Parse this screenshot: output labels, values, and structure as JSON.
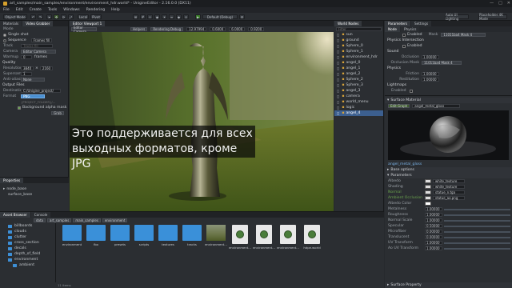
{
  "window": {
    "title": "art_samples/main_samples/environment/environment_hdr.world* - UnigineEditor - 2.16.0.0 (DX11)",
    "controls": [
      "—",
      "□",
      "✕"
    ]
  },
  "menu": [
    "File",
    "Edit",
    "Create",
    "Tools",
    "Windows",
    "Rendering",
    "Help"
  ],
  "toolbar": {
    "object_mode": "Object Mode",
    "local": "Local",
    "pivot": "Pivot",
    "play_label": "Default (Debug)",
    "fps_label": "Auto UI Lighting",
    "theme_label": "Placeholder 4K Mode"
  },
  "left_panel": {
    "tabs": [
      "Materials",
      "Video Grabber"
    ],
    "mode_label": "Mode",
    "modes": [
      "Single shot",
      "Sequence"
    ],
    "fps_label": "FPS",
    "fps_value": "Frames fill",
    "track_label": "Track",
    "track_value": "Tracks fill",
    "camera_label": "Camera",
    "camera_value": "Editor Camera",
    "warmup_label": "Warmup",
    "warmup_value": "0",
    "warmup_unit": "frames",
    "quality_section": "Quality",
    "resolution_label": "Resolution",
    "res_w": "3840",
    "res_h": "2160",
    "supersampling_label": "Supersampling",
    "supersampling_value": "1",
    "anti_alias_label": "Anti-aliasing",
    "anti_alias_value": "None",
    "output_section": "Output Files",
    "destination_label": "Destination",
    "destination_value": "C:/Unigine_project/",
    "format_label": "Format",
    "format_value": "PNG",
    "filename_hint": "{PROJECT_FOLDER}/...",
    "background_alpha": "Background alpha mask",
    "grab_button": "Grab"
  },
  "properties_panel": {
    "title": "Properties",
    "items": [
      "node_base",
      "surface_base"
    ]
  },
  "viewport": {
    "tab": "Editor Viewport 1",
    "camera_label": "Editor Camera",
    "overlay_items": [
      "Helpers",
      "Rendering Debug",
      "Mode",
      "Speed"
    ],
    "speed_values": [
      "12.97994",
      "0.6000",
      "6.0000",
      "0.9200"
    ]
  },
  "subtitle": {
    "line1": "Это поддерживается для всех",
    "line2": "выходных форматов, кроме JPG"
  },
  "world_nodes": {
    "title": "World Nodes",
    "filter_placeholder": "Filter",
    "items": [
      "sun",
      "ground",
      "Sphere_0",
      "Sphere_1",
      "environment_hdr",
      "angel_0",
      "angel_1",
      "angel_2",
      "Sphere_2",
      "Sphere_3",
      "angel_3",
      "camera",
      "world_menu",
      "logic",
      "angel_4"
    ],
    "selected_index": 14
  },
  "parameters": {
    "tabs": [
      "Parameters",
      "Settings"
    ],
    "subtabs": [
      "Node",
      "Physics"
    ],
    "enabled_label": "Enabled",
    "mask_label": "Mask",
    "mask_value": "11011ba4 Mask 4",
    "physics_intersection": "Physics Intersection",
    "sound_section": "Sound",
    "occlusion_label": "Occlusion",
    "occlusion_value": "1.00000",
    "occlusion_mask_label": "Occlusion Mask",
    "physics_section": "Physics",
    "friction_label": "Friction",
    "friction_value": "1.00000",
    "restitution_label": "Restitution",
    "restitution_value": "1.00000",
    "lightmaps_section": "Lightmaps",
    "surface_material_section": "Surface Material",
    "edit_graph": "Edit Graph",
    "material_name": "angel_metal_gloss",
    "base_options": "Base options",
    "parameters_section": "Parameters",
    "params": [
      {
        "label": "Albedo",
        "value": "white_texture"
      },
      {
        "label": "Shading",
        "value": "white_texture"
      },
      {
        "label": "Normal",
        "value": "statue_n.tga",
        "highlight": true
      },
      {
        "label": "Ambient Occlusion",
        "value": "statue_ao.png",
        "highlight": true
      },
      {
        "label": "Albedo Color",
        "value": ""
      },
      {
        "label": "Metalness",
        "value": "1.00000"
      },
      {
        "label": "Roughness",
        "value": "1.00000"
      },
      {
        "label": "Normal Scale",
        "value": "1.00000"
      },
      {
        "label": "Specular",
        "value": "0.50000"
      },
      {
        "label": "Microfiber",
        "value": "0.00000"
      },
      {
        "label": "Translucent",
        "value": "0.00000"
      },
      {
        "label": "UV Transform",
        "value": "1.00000"
      },
      {
        "label": "Ao UV Transform",
        "value": "1.00000"
      }
    ],
    "surface_property": "Surface Property",
    "colors": {
      "accent": "#3c5f8f",
      "highlight": "#6aa34d"
    }
  },
  "asset_browser": {
    "tabs": [
      "Asset Browser",
      "Console"
    ],
    "breadcrumb": [
      "data",
      "art_samples",
      "main_samples",
      "environment"
    ],
    "folders": [
      "billboards",
      "clouds",
      "clutter",
      "cross_section",
      "decals",
      "depth_of_field",
      "environment",
      "ambient"
    ],
    "files": [
      "environment",
      "fbx",
      "presets",
      "scripts",
      "textures",
      "tracks",
      "environment...",
      "environment...",
      "environment...",
      "environment...",
      "hdpe.world"
    ],
    "status": "11 items"
  }
}
